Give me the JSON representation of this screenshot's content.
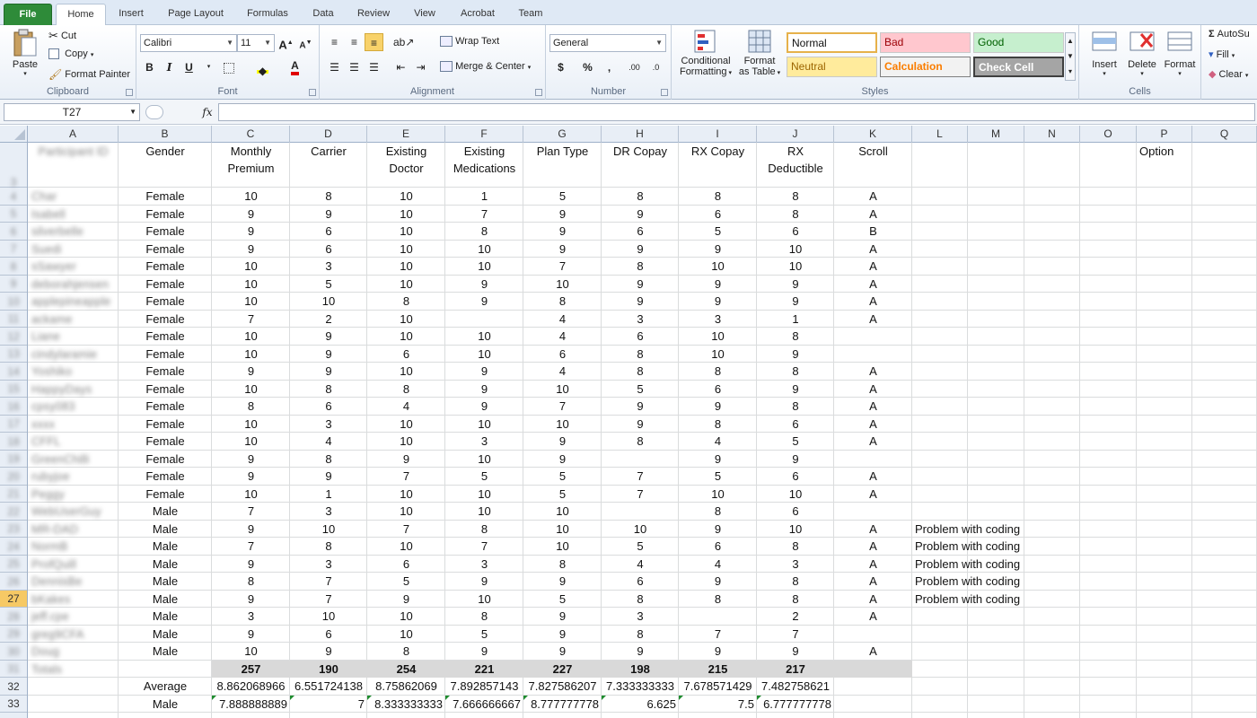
{
  "tabs": {
    "file": "File",
    "home": "Home",
    "insert": "Insert",
    "page_layout": "Page Layout",
    "formulas": "Formulas",
    "data": "Data",
    "review": "Review",
    "view": "View",
    "acrobat": "Acrobat",
    "team": "Team"
  },
  "ribbon": {
    "clipboard": {
      "label": "Clipboard",
      "paste": "Paste",
      "cut": "Cut",
      "copy": "Copy",
      "format_painter": "Format Painter"
    },
    "font": {
      "label": "Font",
      "name": "Calibri",
      "size": "11",
      "bold": "B",
      "italic": "I",
      "underline": "U",
      "grow": "A",
      "shrink": "A"
    },
    "alignment": {
      "label": "Alignment",
      "wrap_text": "Wrap Text",
      "merge_center": "Merge & Center"
    },
    "number": {
      "label": "Number",
      "format": "General",
      "currency": "$",
      "percent": "%",
      "comma": ",",
      "inc_dec": ".00",
      "dec_dec": ".0"
    },
    "styles": {
      "label": "Styles",
      "conditional_1": "Conditional",
      "conditional_2": "Formatting",
      "format_table_1": "Format",
      "format_table_2": "as Table",
      "normal": "Normal",
      "bad": "Bad",
      "good": "Good",
      "neutral": "Neutral",
      "calculation": "Calculation",
      "check_cell": "Check Cell"
    },
    "cells": {
      "label": "Cells",
      "insert": "Insert",
      "delete": "Delete",
      "format": "Format"
    },
    "editing": {
      "autosum": "AutoSu",
      "fill": "Fill",
      "clear": "Clear"
    }
  },
  "formula_bar": {
    "name_box": "T27",
    "fx": "fx",
    "value": ""
  },
  "columns": [
    "A",
    "B",
    "C",
    "D",
    "E",
    "F",
    "G",
    "H",
    "I",
    "J",
    "K",
    "L",
    "M",
    "N",
    "O",
    "P",
    "Q"
  ],
  "header_row": {
    "row_num": "3",
    "A": "Participant ID",
    "B": "Gender",
    "C": [
      "Monthly",
      "Premium"
    ],
    "D": "Carrier",
    "E": [
      "Existing",
      "Doctor"
    ],
    "F": [
      "Existing",
      "Medications"
    ],
    "G": "Plan Type",
    "H": "DR Copay",
    "I": "RX Copay",
    "J": [
      "RX",
      "Deductible"
    ],
    "K": "Scroll",
    "P": "Option"
  },
  "rows": [
    {
      "num": "4",
      "id": "Char",
      "B": "Female",
      "C": "10",
      "D": "8",
      "E": "10",
      "F": "1",
      "G": "5",
      "H": "8",
      "I": "8",
      "J": "8",
      "K": "A",
      "L": ""
    },
    {
      "num": "5",
      "id": "Isabell",
      "B": "Female",
      "C": "9",
      "D": "9",
      "E": "10",
      "F": "7",
      "G": "9",
      "H": "9",
      "I": "6",
      "J": "8",
      "K": "A",
      "L": ""
    },
    {
      "num": "6",
      "id": "silverbelle",
      "B": "Female",
      "C": "9",
      "D": "6",
      "E": "10",
      "F": "8",
      "G": "9",
      "H": "6",
      "I": "5",
      "J": "6",
      "K": "B",
      "L": ""
    },
    {
      "num": "7",
      "id": "Suedi",
      "B": "Female",
      "C": "9",
      "D": "6",
      "E": "10",
      "F": "10",
      "G": "9",
      "H": "9",
      "I": "9",
      "J": "10",
      "K": "A",
      "L": ""
    },
    {
      "num": "8",
      "id": "sSawyer",
      "B": "Female",
      "C": "10",
      "D": "3",
      "E": "10",
      "F": "10",
      "G": "7",
      "H": "8",
      "I": "10",
      "J": "10",
      "K": "A",
      "L": ""
    },
    {
      "num": "9",
      "id": "deborahjensen",
      "B": "Female",
      "C": "10",
      "D": "5",
      "E": "10",
      "F": "9",
      "G": "10",
      "H": "9",
      "I": "9",
      "J": "9",
      "K": "A",
      "L": ""
    },
    {
      "num": "10",
      "id": "applepineapple",
      "B": "Female",
      "C": "10",
      "D": "10",
      "E": "8",
      "F": "9",
      "G": "8",
      "H": "9",
      "I": "9",
      "J": "9",
      "K": "A",
      "L": ""
    },
    {
      "num": "11",
      "id": "ackame",
      "B": "Female",
      "C": "7",
      "D": "2",
      "E": "10",
      "F": "",
      "G": "4",
      "H": "3",
      "I": "3",
      "J": "1",
      "K": "A",
      "L": ""
    },
    {
      "num": "12",
      "id": "Liane",
      "B": "Female",
      "C": "10",
      "D": "9",
      "E": "10",
      "F": "10",
      "G": "4",
      "H": "6",
      "I": "10",
      "J": "8",
      "K": "",
      "L": ""
    },
    {
      "num": "13",
      "id": "cindylaramie",
      "B": "Female",
      "C": "10",
      "D": "9",
      "E": "6",
      "F": "10",
      "G": "6",
      "H": "8",
      "I": "10",
      "J": "9",
      "K": "",
      "L": ""
    },
    {
      "num": "14",
      "id": "Yoshiko",
      "B": "Female",
      "C": "9",
      "D": "9",
      "E": "10",
      "F": "9",
      "G": "4",
      "H": "8",
      "I": "8",
      "J": "8",
      "K": "A",
      "L": ""
    },
    {
      "num": "15",
      "id": "HappyDays",
      "B": "Female",
      "C": "10",
      "D": "8",
      "E": "8",
      "F": "9",
      "G": "10",
      "H": "5",
      "I": "6",
      "J": "9",
      "K": "A",
      "L": ""
    },
    {
      "num": "16",
      "id": "cpsy083",
      "B": "Female",
      "C": "8",
      "D": "6",
      "E": "4",
      "F": "9",
      "G": "7",
      "H": "9",
      "I": "9",
      "J": "8",
      "K": "A",
      "L": ""
    },
    {
      "num": "17",
      "id": "xxxx",
      "B": "Female",
      "C": "10",
      "D": "3",
      "E": "10",
      "F": "10",
      "G": "10",
      "H": "9",
      "I": "8",
      "J": "6",
      "K": "A",
      "L": ""
    },
    {
      "num": "18",
      "id": "CFFL",
      "B": "Female",
      "C": "10",
      "D": "4",
      "E": "10",
      "F": "3",
      "G": "9",
      "H": "8",
      "I": "4",
      "J": "5",
      "K": "A",
      "L": ""
    },
    {
      "num": "19",
      "id": "GreenChilli",
      "B": "Female",
      "C": "9",
      "D": "8",
      "E": "9",
      "F": "10",
      "G": "9",
      "H": "",
      "I": "9",
      "J": "9",
      "K": "",
      "L": ""
    },
    {
      "num": "20",
      "id": "rubyjoe",
      "B": "Female",
      "C": "9",
      "D": "9",
      "E": "7",
      "F": "5",
      "G": "5",
      "H": "7",
      "I": "5",
      "J": "6",
      "K": "A",
      "L": ""
    },
    {
      "num": "21",
      "id": "Peggy",
      "B": "Female",
      "C": "10",
      "D": "1",
      "E": "10",
      "F": "10",
      "G": "5",
      "H": "7",
      "I": "10",
      "J": "10",
      "K": "A",
      "L": ""
    },
    {
      "num": "22",
      "id": "WebUserGuy",
      "B": "Male",
      "C": "7",
      "D": "3",
      "E": "10",
      "F": "10",
      "G": "10",
      "H": "",
      "I": "8",
      "J": "6",
      "K": "",
      "L": ""
    },
    {
      "num": "23",
      "id": "MR-DAD",
      "B": "Male",
      "C": "9",
      "D": "10",
      "E": "7",
      "F": "8",
      "G": "10",
      "H": "10",
      "I": "9",
      "J": "10",
      "K": "A",
      "L": "Problem with coding"
    },
    {
      "num": "24",
      "id": "NormB",
      "B": "Male",
      "C": "7",
      "D": "8",
      "E": "10",
      "F": "7",
      "G": "10",
      "H": "5",
      "I": "6",
      "J": "8",
      "K": "A",
      "L": "Problem with coding"
    },
    {
      "num": "25",
      "id": "ProfQuill",
      "B": "Male",
      "C": "9",
      "D": "3",
      "E": "6",
      "F": "3",
      "G": "8",
      "H": "4",
      "I": "4",
      "J": "3",
      "K": "A",
      "L": "Problem with coding"
    },
    {
      "num": "26",
      "id": "DennisBe",
      "B": "Male",
      "C": "8",
      "D": "7",
      "E": "5",
      "F": "9",
      "G": "9",
      "H": "6",
      "I": "9",
      "J": "8",
      "K": "A",
      "L": "Problem with coding"
    },
    {
      "num": "27",
      "id": "bKakes",
      "B": "Male",
      "C": "9",
      "D": "7",
      "E": "9",
      "F": "10",
      "G": "5",
      "H": "8",
      "I": "8",
      "J": "8",
      "K": "A",
      "L": "Problem with coding"
    },
    {
      "num": "28",
      "id": "jeff.cpe",
      "B": "Male",
      "C": "3",
      "D": "10",
      "E": "10",
      "F": "8",
      "G": "9",
      "H": "3",
      "I": "",
      "J": "2",
      "K": "A",
      "L": ""
    },
    {
      "num": "29",
      "id": "greg9CFA",
      "B": "Male",
      "C": "9",
      "D": "6",
      "E": "10",
      "F": "5",
      "G": "9",
      "H": "8",
      "I": "7",
      "J": "7",
      "K": "",
      "L": ""
    },
    {
      "num": "30",
      "id": "Doug",
      "B": "Male",
      "C": "10",
      "D": "9",
      "E": "8",
      "F": "9",
      "G": "9",
      "H": "9",
      "I": "9",
      "J": "9",
      "K": "A",
      "L": ""
    }
  ],
  "totals_row": {
    "num": "31",
    "label": "Totals",
    "C": "257",
    "D": "190",
    "E": "254",
    "F": "221",
    "G": "227",
    "H": "198",
    "I": "215",
    "J": "217"
  },
  "average_row": {
    "num": "32",
    "label": "Average",
    "C": "8.862068966",
    "D": "6.551724138",
    "E": "8.75862069",
    "F": "7.892857143",
    "G": "7.827586207",
    "H": "7.333333333",
    "I": "7.678571429",
    "J": "7.482758621"
  },
  "male_row": {
    "num": "33",
    "label": "Male",
    "C": "7.888888889",
    "D": "7",
    "E": "8.333333333",
    "F": "7.666666667",
    "G": "8.777777778",
    "H": "6.625",
    "I": "7.5",
    "J": "6.777777778"
  },
  "colors": {
    "file_tab": "#2e8b39",
    "totals_fill": "#d9d9d9",
    "selected_row": "#f6c965",
    "good": "#c6efce",
    "bad": "#ffc7ce",
    "neutral": "#ffeb9c",
    "calc_text": "#fa7d00"
  }
}
